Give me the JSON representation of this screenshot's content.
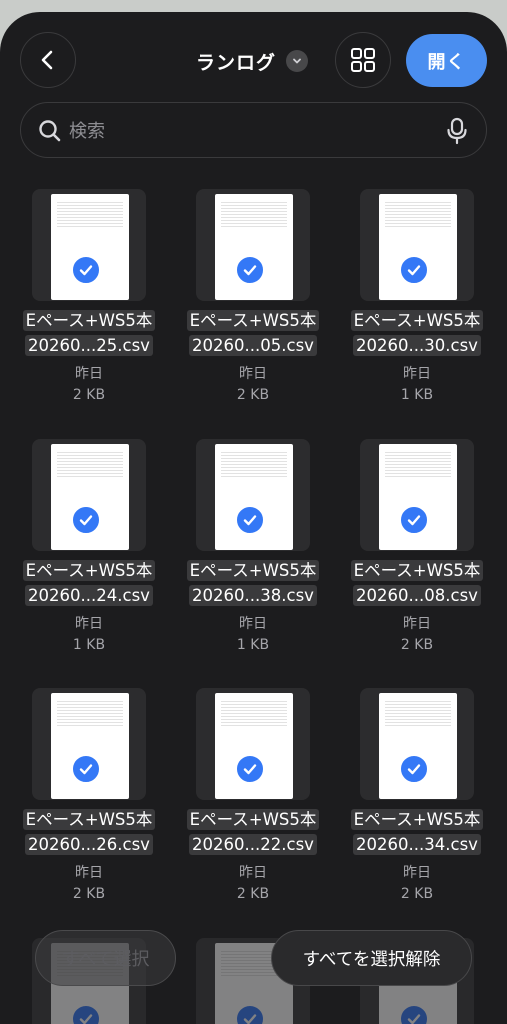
{
  "header": {
    "title": "ランログ",
    "open_label": "開く"
  },
  "search": {
    "placeholder": "検索"
  },
  "files": [
    {
      "line1": "Eペース+WS5本",
      "line2": "20260...25.csv",
      "date": "昨日",
      "size": "2 KB",
      "selected": true
    },
    {
      "line1": "Eペース+WS5本",
      "line2": "20260...05.csv",
      "date": "昨日",
      "size": "2 KB",
      "selected": true
    },
    {
      "line1": "Eペース+WS5本",
      "line2": "20260...30.csv",
      "date": "昨日",
      "size": "1 KB",
      "selected": true
    },
    {
      "line1": "Eペース+WS5本",
      "line2": "20260...24.csv",
      "date": "昨日",
      "size": "1 KB",
      "selected": true
    },
    {
      "line1": "Eペース+WS5本",
      "line2": "20260...38.csv",
      "date": "昨日",
      "size": "1 KB",
      "selected": true
    },
    {
      "line1": "Eペース+WS5本",
      "line2": "20260...08.csv",
      "date": "昨日",
      "size": "2 KB",
      "selected": true
    },
    {
      "line1": "Eペース+WS5本",
      "line2": "20260...26.csv",
      "date": "昨日",
      "size": "2 KB",
      "selected": true
    },
    {
      "line1": "Eペース+WS5本",
      "line2": "20260...22.csv",
      "date": "昨日",
      "size": "2 KB",
      "selected": true
    },
    {
      "line1": "Eペース+WS5本",
      "line2": "20260...34.csv",
      "date": "昨日",
      "size": "2 KB",
      "selected": true
    }
  ],
  "footer": {
    "select_all_label": "すべて選択",
    "deselect_all_label": "すべてを選択解除"
  },
  "colors": {
    "accent": "#4a8ef0",
    "check": "#3478f6",
    "background": "#1c1c1e"
  }
}
